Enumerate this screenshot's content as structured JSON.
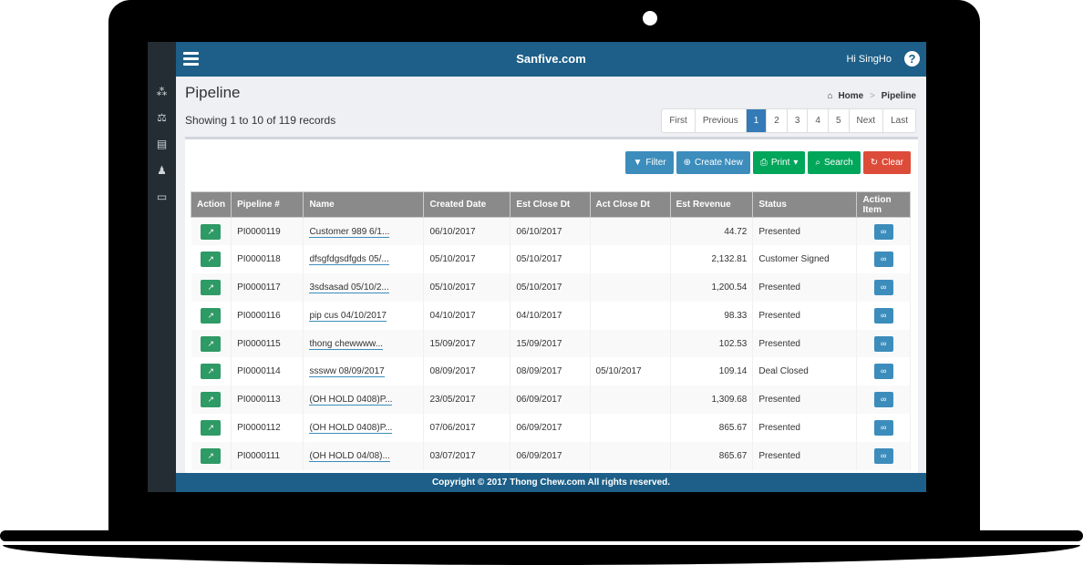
{
  "app": {
    "brand": "Sanfive.com",
    "greeting": "Hi SingHo",
    "help_icon": "?"
  },
  "sidebar": {
    "items": [
      {
        "name": "sidebar-item-dashboard",
        "icon": "cubes-icon",
        "glyph": "⁂"
      },
      {
        "name": "sidebar-item-balance",
        "icon": "balance-scale-icon",
        "glyph": "⚖"
      },
      {
        "name": "sidebar-item-documents",
        "icon": "files-icon",
        "glyph": "▤"
      },
      {
        "name": "sidebar-item-users",
        "icon": "users-icon",
        "glyph": "♟"
      },
      {
        "name": "sidebar-item-desktop",
        "icon": "desktop-icon",
        "glyph": "▭"
      }
    ]
  },
  "page": {
    "title": "Pipeline",
    "record_count": "Showing 1 to 10 of 119 records"
  },
  "breadcrumb": {
    "home_icon": "⌂",
    "home": "Home",
    "separator": ">",
    "current": "Pipeline"
  },
  "pagination": {
    "first": "First",
    "previous": "Previous",
    "pages": [
      "1",
      "2",
      "3",
      "4",
      "5"
    ],
    "active_page": "1",
    "next": "Next",
    "last": "Last"
  },
  "toolbar": {
    "filter": {
      "icon": "▼",
      "label": "Filter"
    },
    "create_new": {
      "icon": "⊕",
      "label": "Create New"
    },
    "print": {
      "icon": "⎙",
      "label": "Print",
      "caret": "▾"
    },
    "search": {
      "icon": "⌕",
      "label": "Search"
    },
    "clear": {
      "icon": "↻",
      "label": "Clear"
    }
  },
  "table": {
    "columns": [
      "Action",
      "Pipeline #",
      "Name",
      "Created Date",
      "Est Close Dt",
      "Act Close Dt",
      "Est Revenue",
      "Status",
      "Action Item"
    ],
    "action_icon": "↗",
    "link_icon": "∞",
    "rows": [
      {
        "id": "PI0000119",
        "name": "Customer 989 6/1...",
        "created": "06/10/2017",
        "est_close": "06/10/2017",
        "act_close": "",
        "revenue": "44.72",
        "status": "Presented"
      },
      {
        "id": "PI0000118",
        "name": "dfsgfdgsdfgds 05/...",
        "created": "05/10/2017",
        "est_close": "05/10/2017",
        "act_close": "",
        "revenue": "2,132.81",
        "status": "Customer Signed"
      },
      {
        "id": "PI0000117",
        "name": "3sdsasad 05/10/2...",
        "created": "05/10/2017",
        "est_close": "05/10/2017",
        "act_close": "",
        "revenue": "1,200.54",
        "status": "Presented"
      },
      {
        "id": "PI0000116",
        "name": "pip cus 04/10/2017",
        "created": "04/10/2017",
        "est_close": "04/10/2017",
        "act_close": "",
        "revenue": "98.33",
        "status": "Presented"
      },
      {
        "id": "PI0000115",
        "name": "thong chewwww...",
        "created": "15/09/2017",
        "est_close": "15/09/2017",
        "act_close": "",
        "revenue": "102.53",
        "status": "Presented"
      },
      {
        "id": "PI0000114",
        "name": "sssww 08/09/2017",
        "created": "08/09/2017",
        "est_close": "08/09/2017",
        "act_close": "05/10/2017",
        "revenue": "109.14",
        "status": "Deal Closed"
      },
      {
        "id": "PI0000113",
        "name": "(OH HOLD 0408)P...",
        "created": "23/05/2017",
        "est_close": "06/09/2017",
        "act_close": "",
        "revenue": "1,309.68",
        "status": "Presented"
      },
      {
        "id": "PI0000112",
        "name": "(OH HOLD 0408)P...",
        "created": "07/06/2017",
        "est_close": "06/09/2017",
        "act_close": "",
        "revenue": "865.67",
        "status": "Presented"
      },
      {
        "id": "PI0000111",
        "name": "(OH HOLD 04/08)...",
        "created": "03/07/2017",
        "est_close": "06/09/2017",
        "act_close": "",
        "revenue": "865.67",
        "status": "Presented"
      }
    ]
  },
  "footer": {
    "text": "Copyright © 2017 Thong Chew.com All rights reserved."
  }
}
